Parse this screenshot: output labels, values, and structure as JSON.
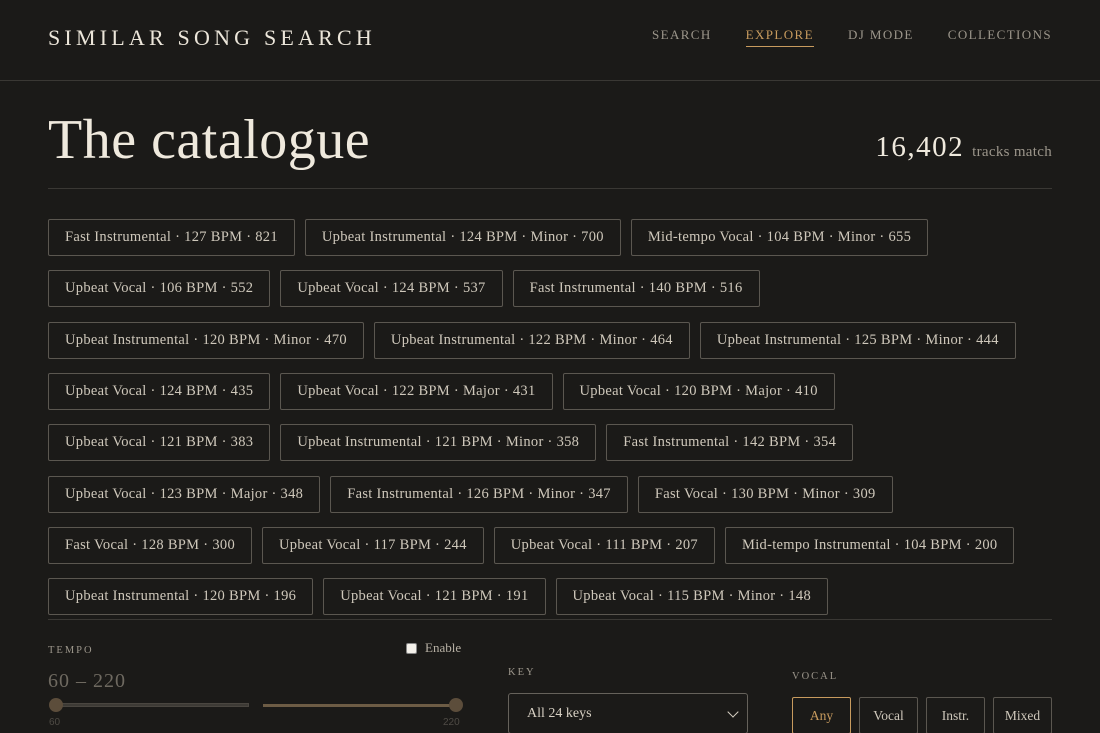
{
  "app": {
    "brand": "SIMILAR SONG SEARCH"
  },
  "nav": [
    {
      "label": "SEARCH",
      "active": false
    },
    {
      "label": "EXPLORE",
      "active": true
    },
    {
      "label": "DJ MODE",
      "active": false
    },
    {
      "label": "COLLECTIONS",
      "active": false
    }
  ],
  "page": {
    "title": "The catalogue",
    "count": "16,402",
    "count_label": "tracks match"
  },
  "chips": [
    "Fast Instrumental · 127 BPM · 821",
    "Upbeat Instrumental · 124 BPM · Minor · 700",
    "Mid-tempo Vocal · 104 BPM · Minor · 655",
    "Upbeat Vocal · 106 BPM · 552",
    "Upbeat Vocal · 124 BPM · 537",
    "Fast Instrumental · 140 BPM · 516",
    "Upbeat Instrumental · 120 BPM · Minor · 470",
    "Upbeat Instrumental · 122 BPM · Minor · 464",
    "Upbeat Instrumental · 125 BPM · Minor · 444",
    "Upbeat Vocal · 124 BPM · 435",
    "Upbeat Vocal · 122 BPM · Major · 431",
    "Upbeat Vocal · 120 BPM · Major · 410",
    "Upbeat Vocal · 121 BPM · 383",
    "Upbeat Instrumental · 121 BPM · Minor · 358",
    "Fast Instrumental · 142 BPM · 354",
    "Upbeat Vocal · 123 BPM · Major · 348",
    "Fast Instrumental · 126 BPM · Minor · 347",
    "Fast Vocal · 130 BPM · Minor · 309",
    "Fast Vocal · 128 BPM · 300",
    "Upbeat Vocal · 117 BPM · 244",
    "Upbeat Vocal · 111 BPM · 207",
    "Mid-tempo Instrumental · 104 BPM · 200",
    "Upbeat Instrumental · 120 BPM · 196",
    "Upbeat Vocal · 121 BPM · 191",
    "Upbeat Vocal · 115 BPM · Minor · 148"
  ],
  "filters": {
    "tempo": {
      "label": "TEMPO",
      "enable_label": "Enable",
      "enabled": false,
      "value_text": "60 – 220",
      "min_label": "60",
      "max_label": "220"
    },
    "key": {
      "label": "KEY",
      "selected": "All 24 keys"
    },
    "vocal": {
      "label": "VOCAL",
      "options": [
        {
          "label": "Any",
          "active": true
        },
        {
          "label": "Vocal",
          "active": false
        },
        {
          "label": "Instr.",
          "active": false
        },
        {
          "label": "Mixed",
          "active": false
        }
      ]
    }
  },
  "colors": {
    "background": "#1b1a18",
    "accent": "#c89b5e",
    "text": "#e8e2d6",
    "muted": "#9c968b"
  }
}
